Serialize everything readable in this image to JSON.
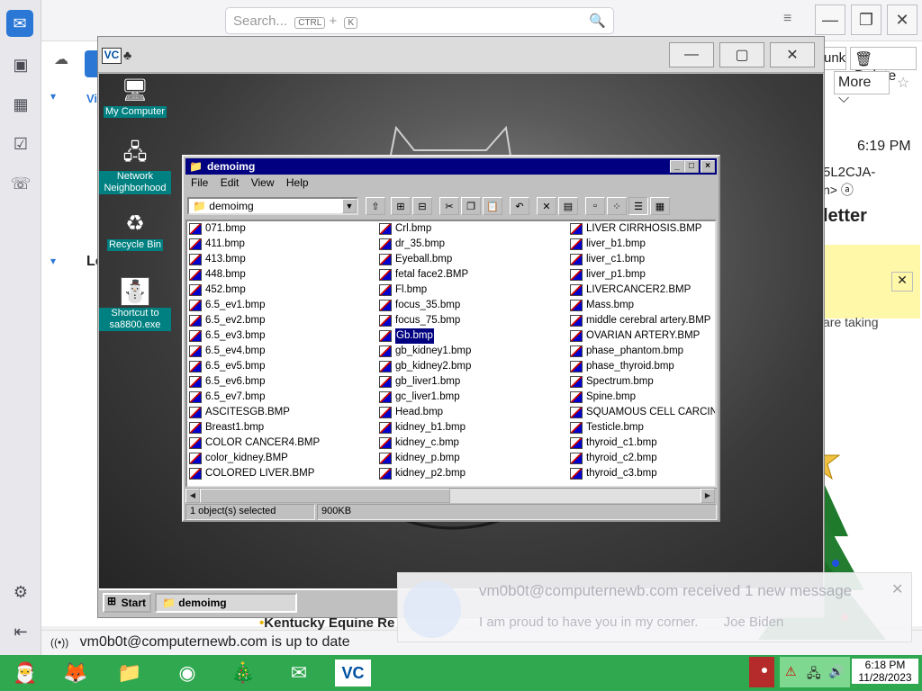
{
  "thunderbird": {
    "search_placeholder": "Search...",
    "search_kbd1": "CTRL",
    "search_plus": "+",
    "search_kbd2": "K",
    "btn_junk": "unk",
    "btn_delete": "Delete",
    "btn_more": "More",
    "time": "6:19 PM",
    "sender_frag1": "5L2CJA-",
    "sender_frag2": "n>",
    "subject_frag": "letter",
    "body_frag": "are taking",
    "folder_frag1": "Vi",
    "folder_frag2": "Lo",
    "status_text": "vm0b0t@computernewb.com is up to date",
    "message_preview": "Kentucky Equine Re"
  },
  "vm": {
    "desktop_icons": [
      {
        "name": "my-computer",
        "label": "My Computer"
      },
      {
        "name": "network-neighborhood",
        "label": "Network Neighborhood"
      },
      {
        "name": "recycle-bin",
        "label": "Recycle Bin"
      },
      {
        "name": "shortcut-sa8800",
        "label": "Shortcut to sa8800.exe"
      }
    ],
    "explorer": {
      "title": "demoimg",
      "menu": [
        "File",
        "Edit",
        "View",
        "Help"
      ],
      "address": "demoimg",
      "columns": [
        [
          "071.bmp",
          "411.bmp",
          "413.bmp",
          "448.bmp",
          "452.bmp",
          "6.5_ev1.bmp",
          "6.5_ev2.bmp",
          "6.5_ev3.bmp",
          "6.5_ev4.bmp",
          "6.5_ev5.bmp",
          "6.5_ev6.bmp",
          "6.5_ev7.bmp",
          "ASCITESGB.BMP",
          "Breast1.bmp",
          "COLOR CANCER4.BMP",
          "color_kidney.BMP",
          "COLORED LIVER.BMP"
        ],
        [
          "Crl.bmp",
          "dr_35.bmp",
          "Eyeball.bmp",
          "fetal face2.BMP",
          "Fl.bmp",
          "focus_35.bmp",
          "focus_75.bmp",
          "Gb.bmp",
          "gb_kidney1.bmp",
          "gb_kidney2.bmp",
          "gb_liver1.bmp",
          "gc_liver1.bmp",
          "Head.bmp",
          "kidney_b1.bmp",
          "kidney_c.bmp",
          "kidney_p.bmp",
          "kidney_p2.bmp"
        ],
        [
          "LIVER CIRRHOSIS.BMP",
          "liver_b1.bmp",
          "liver_c1.bmp",
          "liver_p1.bmp",
          "LIVERCANCER2.BMP",
          "Mass.bmp",
          "middle cerebral artery.BMP",
          "OVARIAN ARTERY.BMP",
          "phase_phantom.bmp",
          "phase_thyroid.bmp",
          "Spectrum.bmp",
          "Spine.bmp",
          "SQUAMOUS CELL CARCINOMA",
          "Testicle.bmp",
          "thyroid_c1.bmp",
          "thyroid_c2.bmp",
          "thyroid_c3.bmp"
        ]
      ],
      "selected": "Gb.bmp",
      "status_selected": "1 object(s) selected",
      "status_size": "900KB"
    },
    "taskbar": {
      "start": "Start",
      "task": "demoimg"
    }
  },
  "notification": {
    "title": "vm0b0t@computernewb.com received 1 new message",
    "body": "I am proud to have you in my corner.",
    "sender": "Joe Biden"
  },
  "win_taskbar": {
    "time": "6:18 PM",
    "date": "11/28/2023",
    "apps": [
      "santa",
      "firefox",
      "file-explorer",
      "chrome",
      "tree",
      "thunderbird",
      "vc"
    ]
  }
}
